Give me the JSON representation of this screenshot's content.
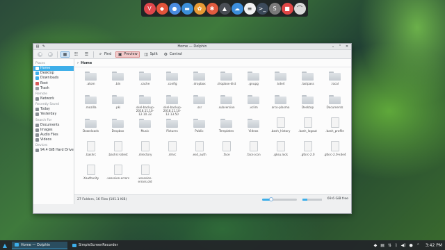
{
  "dock": {
    "apps": [
      {
        "name": "vivaldi-icon",
        "glyph": "V",
        "color": "#e0464b"
      },
      {
        "name": "gitlab-icon",
        "glyph": "◆",
        "color": "#e2533a"
      },
      {
        "name": "chromium-icon",
        "glyph": "●",
        "color": "#4a8be0"
      },
      {
        "name": "files-icon",
        "glyph": "▬",
        "color": "#3b8fd9"
      },
      {
        "name": "basket-icon",
        "glyph": "✿",
        "color": "#e89a34"
      },
      {
        "name": "settings-icon",
        "glyph": "✱",
        "color": "#e15b3f"
      },
      {
        "name": "inkscape-icon",
        "glyph": "▲",
        "color": "#4a4e55"
      },
      {
        "name": "cloud-icon",
        "glyph": "☁",
        "color": "#3c8edb"
      },
      {
        "name": "document-icon",
        "glyph": "≡",
        "color": "#f2f2f2"
      },
      {
        "name": "terminal-icon",
        "glyph": ">_",
        "color": "#3c4a5a"
      },
      {
        "name": "sublime-icon",
        "glyph": "S",
        "color": "#7a7a7a"
      },
      {
        "name": "recorder-icon",
        "glyph": "■",
        "color": "#e04646"
      },
      {
        "name": "power-icon",
        "glyph": "⌒",
        "color": "#d9d9d9"
      }
    ]
  },
  "window": {
    "title": "Home — Dolphin",
    "toolbar": {
      "find": "Find",
      "preview": "Preview",
      "split": "Split",
      "control": "Control"
    },
    "sidebar": {
      "places_heading": "Places",
      "places": [
        {
          "label": "Home",
          "selected": true,
          "color": "#ffffff"
        },
        {
          "label": "Desktop",
          "selected": false,
          "color": "#3daee9"
        },
        {
          "label": "Downloads",
          "selected": false,
          "color": "#3daee9"
        },
        {
          "label": "Root",
          "selected": false,
          "color": "#d65a5a"
        },
        {
          "label": "Trash",
          "selected": false,
          "color": "#9aa0a6"
        }
      ],
      "remote_heading": "Remote",
      "remote": [
        {
          "label": "Network"
        }
      ],
      "recent_heading": "Recently Saved",
      "recent": [
        {
          "label": "Today"
        },
        {
          "label": "Yesterday"
        }
      ],
      "search_heading": "Search For",
      "search": [
        {
          "label": "Documents"
        },
        {
          "label": "Images"
        },
        {
          "label": "Audio Files"
        },
        {
          "label": "Videos"
        }
      ],
      "devices_heading": "Devices",
      "devices": [
        {
          "label": "94.4 GiB Hard Drive"
        }
      ]
    },
    "breadcrumb": "Home",
    "files": [
      {
        "name": ".atom",
        "kind": "folder"
      },
      {
        "name": ".bin",
        "kind": "folder"
      },
      {
        "name": ".cache",
        "kind": "folder"
      },
      {
        "name": ".config",
        "kind": "folder"
      },
      {
        "name": ".dropbox",
        "kind": "folder"
      },
      {
        "name": ".dropbox-dist",
        "kind": "folder"
      },
      {
        "name": ".gnupg",
        "kind": "folder"
      },
      {
        "name": ".kde4",
        "kind": "folder"
      },
      {
        "name": ".lastpass",
        "kind": "folder"
      },
      {
        "name": ".local",
        "kind": "folder"
      },
      {
        "name": ".mozilla",
        "kind": "folder"
      },
      {
        "name": ".pki",
        "kind": "folder"
      },
      {
        "name": ".skel-backup-2018.11.10-12.10.33",
        "kind": "folder"
      },
      {
        "name": ".skel-backup-2018.11.10-12.13.50",
        "kind": "folder"
      },
      {
        "name": ".ssr",
        "kind": "folder"
      },
      {
        "name": ".subversion",
        "kind": "folder"
      },
      {
        "name": ".vclim",
        "kind": "folder"
      },
      {
        "name": "arco-plasma",
        "kind": "folder"
      },
      {
        "name": "Desktop",
        "kind": "folder"
      },
      {
        "name": "Documents",
        "kind": "folder"
      },
      {
        "name": "Downloads",
        "kind": "folder"
      },
      {
        "name": "Dropbox",
        "kind": "folder"
      },
      {
        "name": "Music",
        "kind": "folder"
      },
      {
        "name": "Pictures",
        "kind": "folder"
      },
      {
        "name": "Public",
        "kind": "folder"
      },
      {
        "name": "Templates",
        "kind": "folder"
      },
      {
        "name": "Videos",
        "kind": "folder"
      },
      {
        "name": ".bash_history",
        "kind": "doc"
      },
      {
        "name": ".bash_logout",
        "kind": "doc"
      },
      {
        "name": ".bash_profile",
        "kind": "doc"
      },
      {
        "name": ".bashrc",
        "kind": "doc"
      },
      {
        "name": ".bashrc-latest",
        "kind": "doc"
      },
      {
        "name": ".directory",
        "kind": "doc"
      },
      {
        "name": ".dmrc",
        "kind": "doc"
      },
      {
        "name": ".esd_auth",
        "kind": "doc"
      },
      {
        "name": ".face",
        "kind": "doc"
      },
      {
        "name": ".face.icon",
        "kind": "doc"
      },
      {
        "name": ".gksu.lock",
        "kind": "doc"
      },
      {
        "name": ".gtkrc-2.0",
        "kind": "doc"
      },
      {
        "name": ".gtkrc-2.0-kde4",
        "kind": "doc"
      },
      {
        "name": ".Xauthority",
        "kind": "doc"
      },
      {
        "name": ".xsession-errors",
        "kind": "doc"
      },
      {
        "name": ".xsession-errors.old",
        "kind": "doc"
      }
    ],
    "status": {
      "summary": "27 Folders, 16 Files (101.1 KiB)",
      "free": "69.6 GiB free",
      "zoom_fraction": 0.25,
      "space_fraction": 0.26
    }
  },
  "taskbar": {
    "tasks": [
      {
        "label": "Home — Dolphin",
        "active": true
      },
      {
        "label": "SimpleScreenRecorder",
        "active": false
      }
    ],
    "clock": "3:42 PM"
  }
}
